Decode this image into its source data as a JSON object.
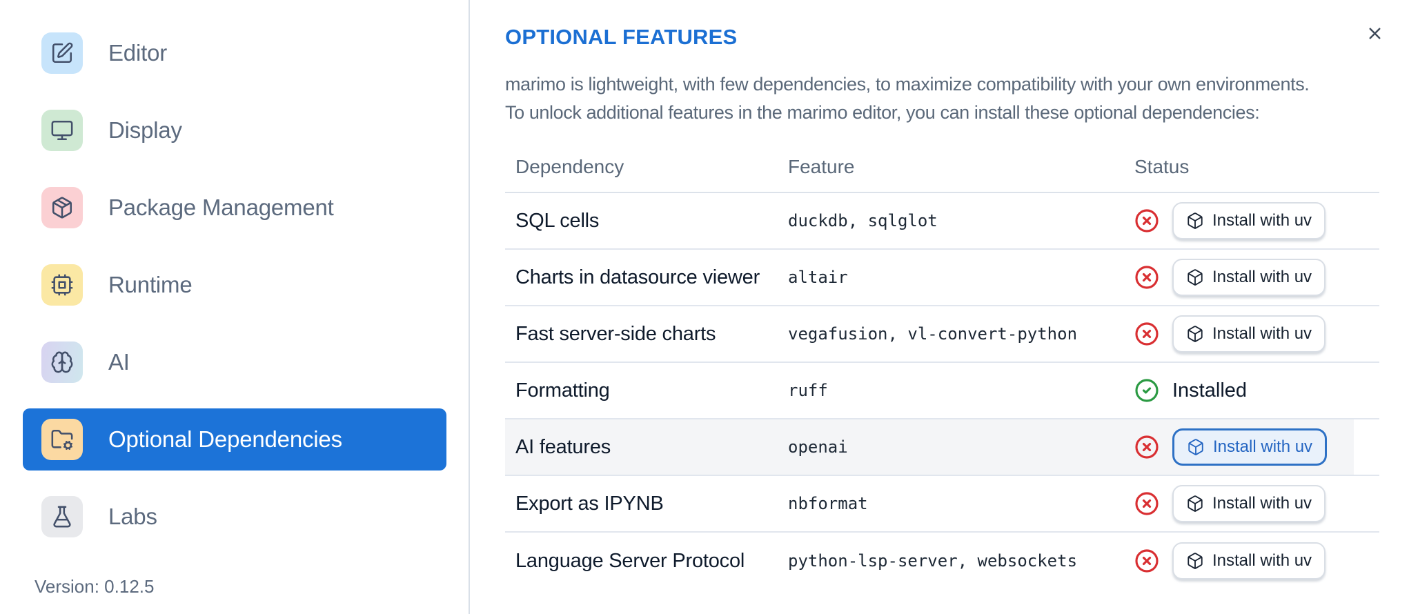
{
  "sidebar": {
    "items": [
      {
        "label": "Editor",
        "icon": "square-pen-icon",
        "icon_bg": "#c7e4fb",
        "selected": false
      },
      {
        "label": "Display",
        "icon": "monitor-icon",
        "icon_bg": "#cfe9d3",
        "selected": false
      },
      {
        "label": "Package Management",
        "icon": "package-icon",
        "icon_bg": "#fbd0d3",
        "selected": false
      },
      {
        "label": "Runtime",
        "icon": "cpu-icon",
        "icon_bg": "#fbe8a4",
        "selected": false
      },
      {
        "label": "AI",
        "icon": "brain-icon",
        "icon_bg": "linear-gradient(100deg, #d8d3f1 0%, #cfe7ee 100%)",
        "selected": false
      },
      {
        "label": "Optional Dependencies",
        "icon": "folder-cog-icon",
        "icon_bg": "#fbd9a2",
        "selected": true
      },
      {
        "label": "Labs",
        "icon": "flask-icon",
        "icon_bg": "#e8e9ec",
        "selected": false
      }
    ],
    "version_label": "Version: 0.12.5"
  },
  "panel": {
    "title": "OPTIONAL FEATURES",
    "description_line1": "marimo is lightweight, with few dependencies, to maximize compatibility with your own environments.",
    "description_line2": "To unlock additional features in the marimo editor, you can install these optional dependencies:"
  },
  "table": {
    "columns": {
      "dependency": "Dependency",
      "feature": "Feature",
      "status": "Status"
    },
    "install_button_label": "Install with uv",
    "installed_label": "Installed",
    "rows": [
      {
        "dependency": "SQL cells",
        "feature": "duckdb, sqlglot",
        "status": "missing",
        "highlighted": false,
        "button_focused": false
      },
      {
        "dependency": "Charts in datasource viewer",
        "feature": "altair",
        "status": "missing",
        "highlighted": false,
        "button_focused": false
      },
      {
        "dependency": "Fast server-side charts",
        "feature": "vegafusion, vl-convert-python",
        "status": "missing",
        "highlighted": false,
        "button_focused": false
      },
      {
        "dependency": "Formatting",
        "feature": "ruff",
        "status": "installed",
        "highlighted": false,
        "button_focused": false
      },
      {
        "dependency": "AI features",
        "feature": "openai",
        "status": "missing",
        "highlighted": true,
        "button_focused": true
      },
      {
        "dependency": "Export as IPYNB",
        "feature": "nbformat",
        "status": "missing",
        "highlighted": false,
        "button_focused": false
      },
      {
        "dependency": "Language Server Protocol",
        "feature": "python-lsp-server, websockets",
        "status": "missing",
        "highlighted": false,
        "button_focused": false
      }
    ]
  },
  "colors": {
    "accent_blue": "#1c73d8",
    "title_blue": "#1b6fd3",
    "status_missing_red": "#d92f32",
    "status_installed_green": "#2b9a43",
    "focused_button_blue": "#2e71c5",
    "sidebar_divider": "#d9e0e8",
    "row_border": "#e1e6ee",
    "muted_text": "#5a6879",
    "dark_text": "#0e1a2b",
    "highlight_row_bg": "#f4f5f7"
  }
}
